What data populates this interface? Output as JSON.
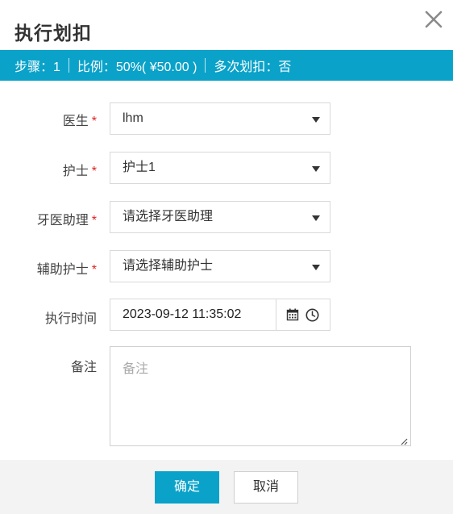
{
  "dialog": {
    "title": "执行划扣"
  },
  "info_bar": {
    "step": "步骤：1",
    "ratio": "比例：50%( ¥50.00 )",
    "multiple": "多次划扣：否"
  },
  "form": {
    "required_mark": "*",
    "doctor": {
      "label": "医生",
      "value": "lhm"
    },
    "nurse": {
      "label": "护士",
      "value": "护士1"
    },
    "dental_assistant": {
      "label": "牙医助理",
      "value": "请选择牙医助理"
    },
    "assistant_nurse": {
      "label": "辅助护士",
      "value": "请选择辅助护士"
    },
    "exec_time": {
      "label": "执行时间",
      "value": "2023-09-12 11:35:02"
    },
    "remark": {
      "label": "备注",
      "placeholder": "备注",
      "value": ""
    }
  },
  "footer": {
    "confirm_label": "确定",
    "cancel_label": "取消"
  },
  "colors": {
    "accent": "#0aa2c9",
    "required": "#e02020"
  },
  "icons": [
    "close-icon",
    "calendar-icon",
    "clock-icon",
    "resize-handle-icon",
    "dropdown-arrow-icon"
  ]
}
